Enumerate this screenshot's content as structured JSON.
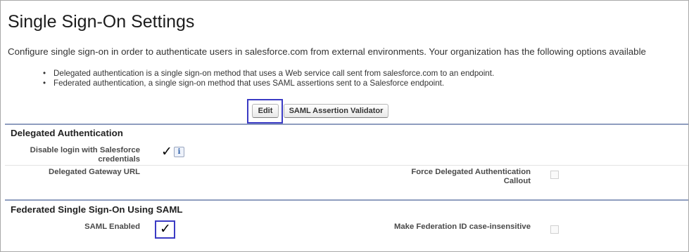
{
  "page": {
    "title": "Single Sign-On Settings",
    "description": "Configure single sign-on in order to authenticate users in salesforce.com from external environments. Your organization has the following options available",
    "bullets": [
      "Delegated authentication is a single sign-on method that uses a Web service call sent from salesforce.com to an endpoint.",
      "Federated authentication, a single sign-on method that uses SAML assertions sent to a Salesforce endpoint."
    ]
  },
  "buttons": {
    "edit": "Edit",
    "saml_validator": "SAML Assertion Validator"
  },
  "delegated": {
    "section_title": "Delegated Authentication",
    "disable_login_label": "Disable login with Salesforce credentials",
    "disable_login_checked": true,
    "checkmark": "✓",
    "info_icon": "i",
    "gateway_url_label": "Delegated Gateway URL",
    "gateway_url_value": "",
    "force_callout_label": "Force Delegated Authentication Callout",
    "force_callout_checked": false
  },
  "federated": {
    "section_title": "Federated Single Sign-On Using SAML",
    "saml_enabled_label": "SAML Enabled",
    "saml_enabled_checked": true,
    "checkmark": "✓",
    "federation_case_label": "Make Federation ID case-insensitive",
    "federation_case_checked": false
  },
  "colors": {
    "highlight": "#3b3bc4",
    "section_bar": "#8e9dbe"
  }
}
